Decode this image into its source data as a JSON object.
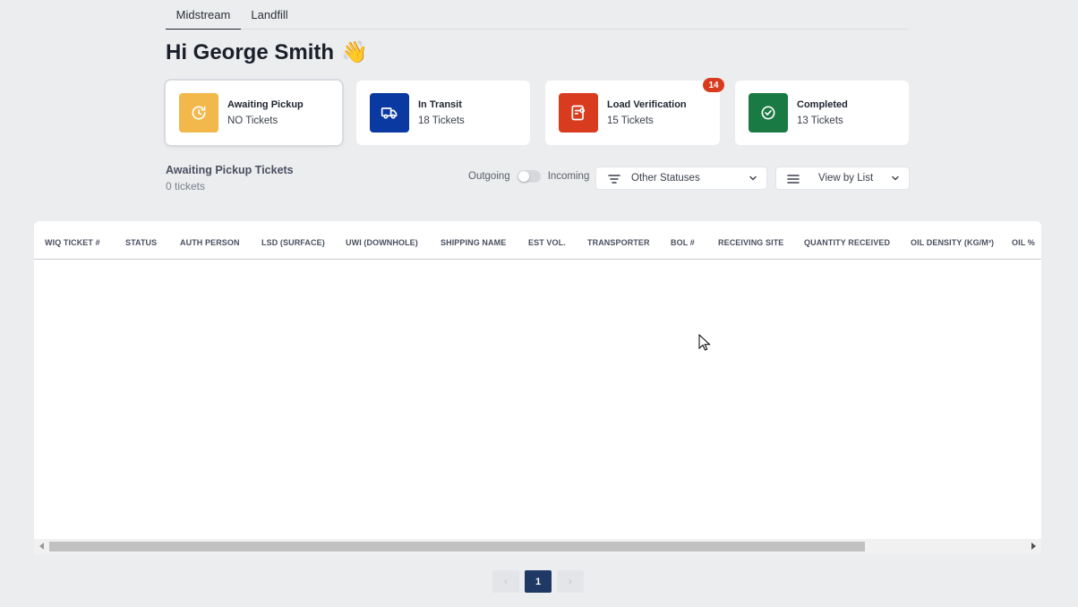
{
  "tabs": [
    {
      "label": "Midstream",
      "active": true
    },
    {
      "label": "Landfill",
      "active": false
    }
  ],
  "greeting": {
    "text": "Hi George Smith",
    "emoji": "👋"
  },
  "cards": [
    {
      "title": "Awaiting Pickup",
      "subtitle": "NO Tickets",
      "color": "#f2b84b",
      "icon": "clock-icon",
      "selected": true
    },
    {
      "title": "In Transit",
      "subtitle": "18 Tickets",
      "color": "#0a3aa1",
      "icon": "truck-icon"
    },
    {
      "title": "Load Verification",
      "subtitle": "15 Tickets",
      "color": "#d93b1f",
      "icon": "clipboard-check-icon",
      "badge": "14"
    },
    {
      "title": "Completed",
      "subtitle": "13 Tickets",
      "color": "#1a7a43",
      "icon": "check-circle-icon"
    }
  ],
  "section": {
    "title": "Awaiting Pickup Tickets",
    "count": "0 tickets"
  },
  "toggle": {
    "left_label": "Outgoing",
    "right_label": "Incoming"
  },
  "filters": {
    "status_label": "Other Statuses",
    "view_label": "View by List"
  },
  "table": {
    "columns": [
      "WIQ TICKET #",
      "STATUS",
      "AUTH PERSON",
      "LSD (SURFACE)",
      "UWI (DOWNHOLE)",
      "SHIPPING NAME",
      "EST VOL.",
      "TRANSPORTER",
      "BOL #",
      "RECEIVING SITE",
      "QUANTITY RECEIVED",
      "OIL DENSITY (KG/M³)",
      "OIL %"
    ],
    "rows": []
  },
  "pagination": {
    "current": "1",
    "prev": "‹",
    "next": "›"
  }
}
